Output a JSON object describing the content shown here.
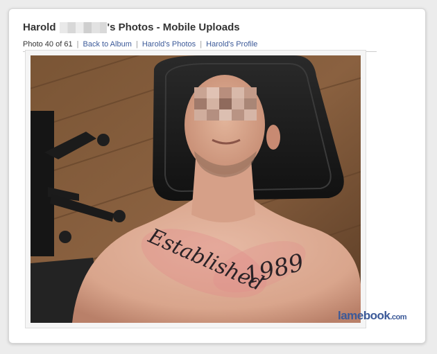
{
  "page": {
    "title_prefix": "Harold",
    "title_suffix": "'s Photos - Mobile Uploads"
  },
  "breadcrumb": {
    "counter": "Photo 40 of 61",
    "back_label": "Back to Album",
    "photos_label": "Harold's Photos",
    "profile_label": "Harold's Profile"
  },
  "photo": {
    "tattoo_line1": "Established",
    "tattoo_line2": "1989"
  },
  "watermark": {
    "brand": "lamebook",
    "suffix": ".com"
  },
  "colors": {
    "link": "#3b5998",
    "title": "#333333"
  }
}
